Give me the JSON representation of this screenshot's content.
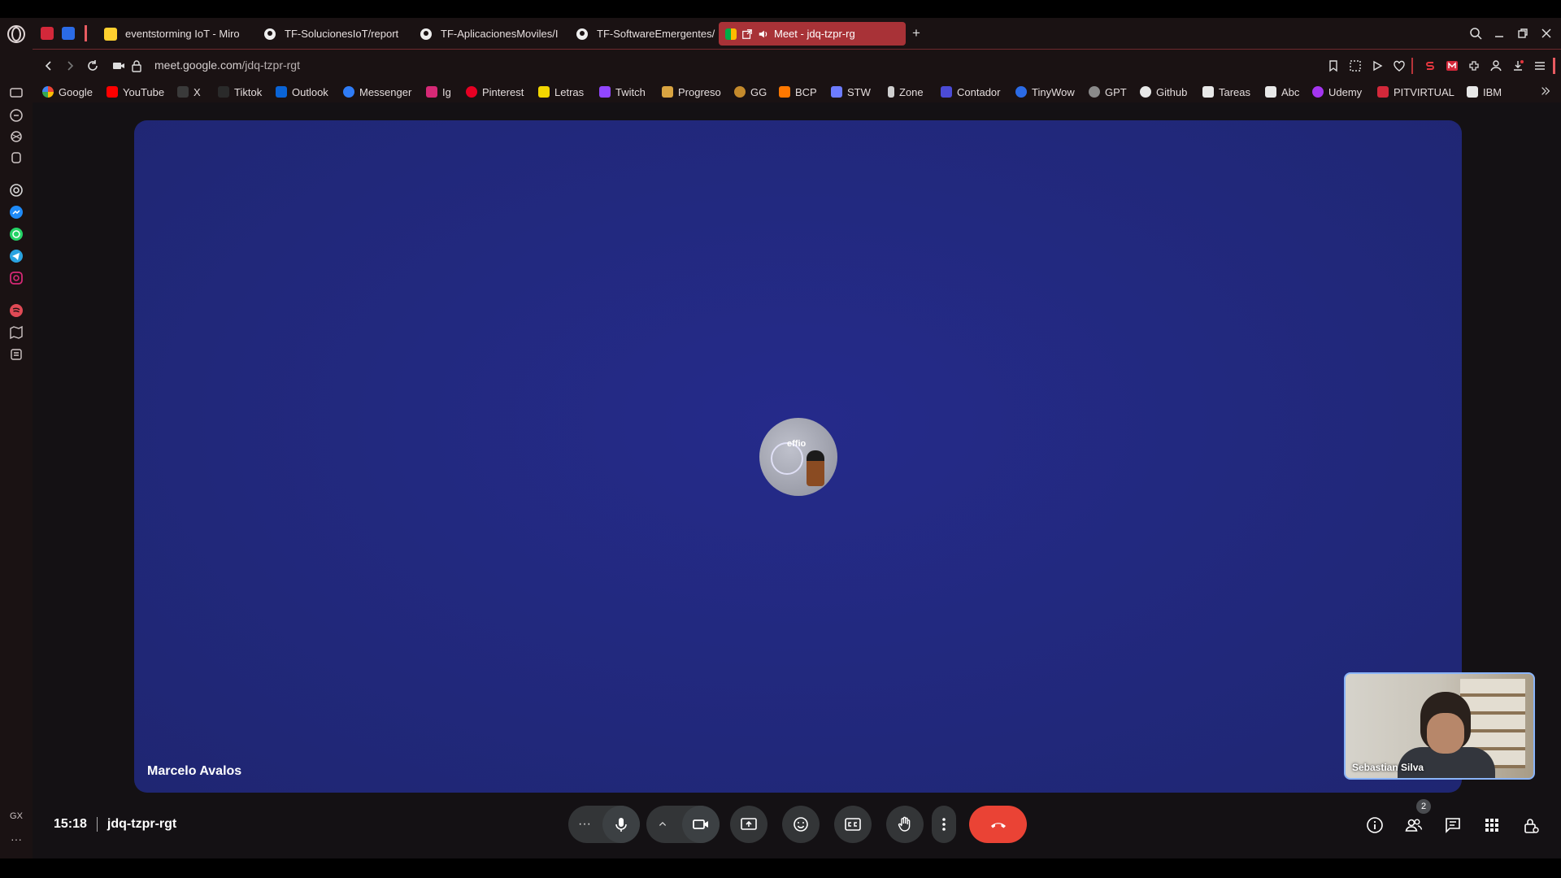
{
  "browser": {
    "tabs": [
      {
        "label": "eventstorming IoT - Miro"
      },
      {
        "label": "TF-SolucionesIoT/report"
      },
      {
        "label": "TF-AplicacionesMoviles/I"
      },
      {
        "label": "TF-SoftwareEmergentes/"
      },
      {
        "label": "Meet - jdq-tzpr-rg"
      }
    ],
    "new_tab_label": "+",
    "url": {
      "host": "meet.google.com",
      "path": "/jdq-tzpr-rgt"
    },
    "bookmarks": [
      {
        "label": "Google",
        "color": "#ffffff"
      },
      {
        "label": "YouTube",
        "color": "#ff0000"
      },
      {
        "label": "X",
        "color": "#000000"
      },
      {
        "label": "Tiktok",
        "color": "#000000"
      },
      {
        "label": "Outlook",
        "color": "#0a64d6"
      },
      {
        "label": "Messenger",
        "color": "#2f7cf6"
      },
      {
        "label": "Ig",
        "color": "#d62976"
      },
      {
        "label": "Pinterest",
        "color": "#e60023"
      },
      {
        "label": "Letras",
        "color": "#f2d600"
      },
      {
        "label": "Twitch",
        "color": "#9146ff"
      },
      {
        "label": "Progreso",
        "color": "#d9a441"
      },
      {
        "label": "GG",
        "color": "#c48a2c"
      },
      {
        "label": "BCP",
        "color": "#ff7800"
      },
      {
        "label": "STW",
        "color": "#6d7cff"
      },
      {
        "label": "Zone",
        "color": "#ffffff"
      },
      {
        "label": "Contador",
        "color": "#4b4bd6"
      },
      {
        "label": "TinyWow",
        "color": "#2b6be6"
      },
      {
        "label": "GPT",
        "color": "#d0d0d0"
      },
      {
        "label": "Github",
        "color": "#ffffff"
      },
      {
        "label": "Tareas",
        "color": "#ffffff"
      },
      {
        "label": "Abc",
        "color": "#ffffff"
      },
      {
        "label": "Udemy",
        "color": "#a435f0"
      },
      {
        "label": "PITVIRTUAL",
        "color": "#d3283a"
      },
      {
        "label": "IBM",
        "color": "#ffffff"
      }
    ],
    "side_bottom_label": "GX",
    "side_more_label": "···"
  },
  "meet": {
    "main_participant": "Marcelo Avalos",
    "avatar_text": "effio",
    "self_participant": "Sebastian Silva",
    "time": "15:18",
    "meeting_code": "jdq-tzpr-rgt",
    "participants_count": "2",
    "more_label": "···"
  },
  "colors": {
    "browser_accent": "#a83237",
    "stage_bg": "#22297f",
    "hangup": "#ea4335",
    "control_bg": "#333537"
  }
}
